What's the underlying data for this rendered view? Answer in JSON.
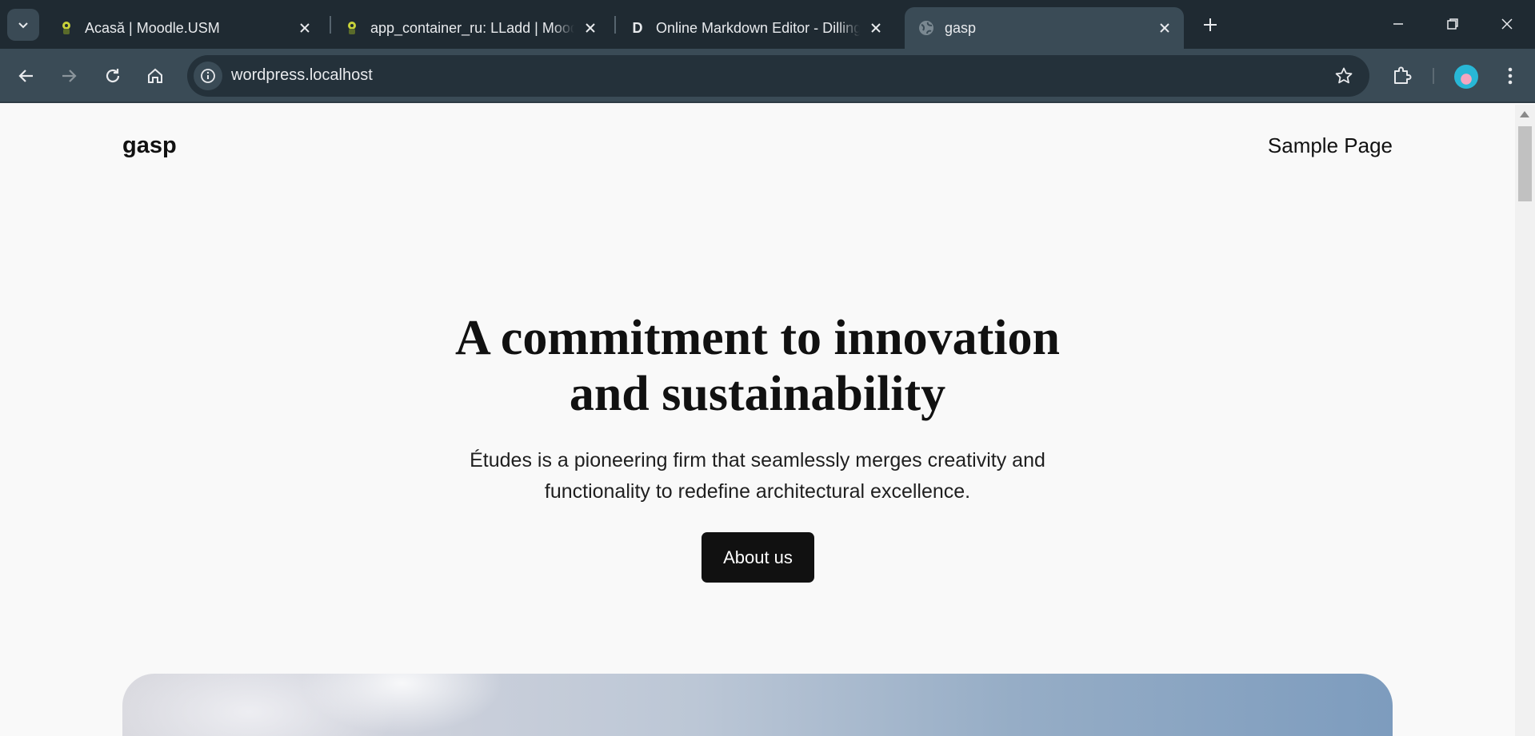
{
  "browser": {
    "tabs": [
      {
        "title": "Acasă | Moodle.USM",
        "favicon": "moodle-icon",
        "active": false
      },
      {
        "title": "app_container_ru: LLadd | Moodle",
        "favicon": "moodle-icon",
        "active": false
      },
      {
        "title": "Online Markdown Editor - Dillinger",
        "favicon_letter": "D",
        "favicon": "dillinger-icon",
        "active": false
      },
      {
        "title": "gasp",
        "favicon": "globe-icon",
        "active": true
      }
    ],
    "url": "wordpress.localhost",
    "colors": {
      "tabstrip": "#1f2a32",
      "toolbar": "#3a4b56",
      "omnibox": "#24313a"
    }
  },
  "site": {
    "title": "gasp",
    "nav": [
      "Sample Page"
    ]
  },
  "hero": {
    "heading_line1": "A commitment to innovation",
    "heading_line2": "and sustainability",
    "subtitle_line1": "Études is a pioneering firm that seamlessly merges creativity and",
    "subtitle_line2": "functionality to redefine architectural excellence.",
    "button_label": "About us"
  }
}
